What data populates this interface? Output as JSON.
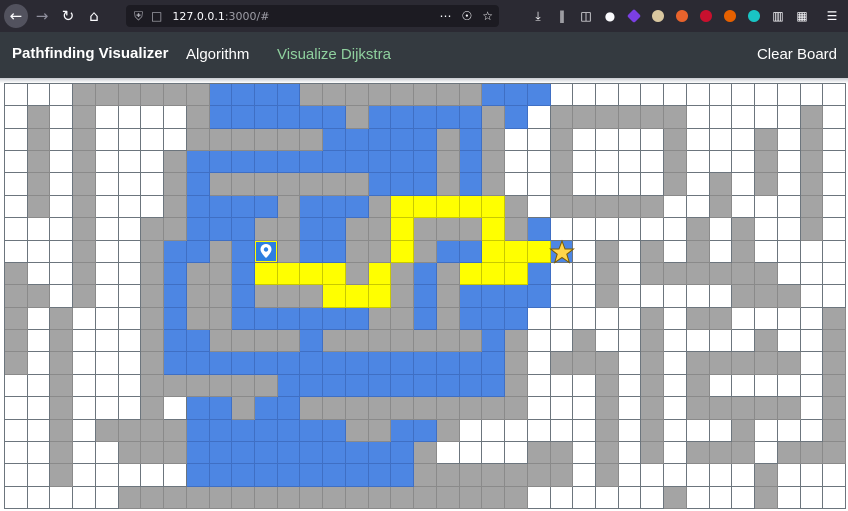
{
  "browser": {
    "url_host": "127.0.0.1",
    "url_rest": ":3000/#"
  },
  "navbar": {
    "brand": "Pathfinding Visualizer",
    "algorithm_label": "Algorithm",
    "visualize_label": "Visualize Dijkstra",
    "clear_label": "Clear Board"
  },
  "colors": {
    "wall": "#a4a4a4",
    "visited": "#4d86e3",
    "path": "#ffff00",
    "empty": "#ffffff",
    "navbar": "#343a40",
    "visualize_accent": "#8fd19e"
  },
  "grid": {
    "rows": 19,
    "cols": 37,
    "legend": {
      ".": "empty",
      "W": "wall",
      "V": "visited",
      "P": "path",
      "S": "start",
      "T": "target"
    },
    "cells": [
      "...WWWWWWVVVVWWWWWWWWVVV.............",
      ".W.W....WVVVVVVWVVVVVWV.WWWWWW.....W.",
      ".W.W....WWWWWWVVVVVWVW..W....W...W.W.",
      ".W.W...WVVVVVVVVVVVWVW..W....W...W.W.",
      ".W.W...WVWWWWWWWVVVWVW..W....W.W.W.W.",
      ".W.W...WVVVVWVVVWPPPPPW.WWWWW..W...W.",
      "...W..WWVVVWWVVWWPWWWPWV......W.W..W.",
      "...W..WVVWVSWVVWWPWVVPPPT.W.W.W.W....",
      "W..W..WVWWVPPPPWPWVWPPPV..W.WWWWWW...",
      "WW.W..WVWWVWWWPPPWVWVVVV..W.....WWW..",
      "W.W...WVWWVVVVVVWWVWVVV.....W.WW....W",
      "W.W...WVVWWWWVWWWWWWWVW..W..W....W..W",
      "W.W...WVVVVVVVVVVVVVVVW.WWW.W.WWWWW.W",
      "..W...WWWWWWVVVVVVVVVVW...W.W.W.....W",
      "..W...W.VVWVVWWWWWWWWWW...W.W.WWWWW.W",
      "..W.WWWWVVVVVVVWWVVW......W.W...W...W",
      "..W..WWWVVVVVVVVVVW....WW.W.W.WWW.WWW",
      "..W.....VVVVVVVVVVWWWWWWW.W......W...",
      ".....WWWWWWWWWWWWWWWWWW......W...W..."
    ]
  }
}
